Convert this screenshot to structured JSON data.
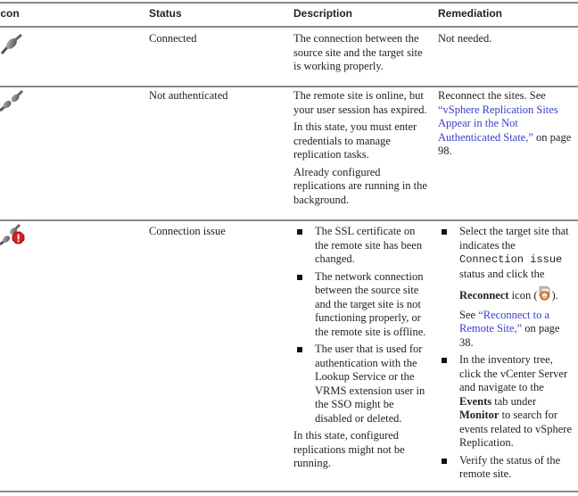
{
  "table": {
    "headers": {
      "icon": "Icon",
      "status": "Status",
      "description": "Description",
      "remediation": "Remediation"
    },
    "rows": [
      {
        "icon": "plug-connected-icon",
        "status": "Connected",
        "description": [
          "The connection between the source site and the target site is working properly."
        ],
        "remediation": "Not needed."
      },
      {
        "icon": "plug-disconnected-icon",
        "status": "Not authenticated",
        "description": [
          "The remote site is online, but your user session has expired.",
          "In this state, you must enter credentials to manage replication tasks.",
          "Already configured replications are running in the background."
        ],
        "remediation": {
          "prefix": "Reconnect the sites. See ",
          "link": "“vSphere Replication Sites Appear in the Not Authenticated State,”",
          "suffix": " on page 98."
        }
      },
      {
        "icon": "plug-error-icon",
        "status": "Connection issue",
        "description_bullets": [
          "The SSL certificate on the remote site has been changed.",
          "The network connection between the source site and the target site is not functioning properly, or the remote site is offline.",
          "The user that is used for authentication with the Lookup Service or the VRMS extension user in the SSO might be disabled or deleted."
        ],
        "description_note": "In this state, configured replications might not be running.",
        "remediation_bullets": {
          "b1_pre": "Select the target site that indicates the ",
          "b1_code": "Connection issue",
          "b1_mid": " status and click the",
          "b1_bold": "Reconnect",
          "b1_icon_pre": " icon (",
          "b1_icon_post": ").",
          "b1_see": "See ",
          "b1_link": "“Reconnect to a Remote Site,”",
          "b1_suffix": " on page 38.",
          "b2_pre": "In the inventory tree, click the vCenter Server and navigate to the ",
          "b2_bold1": "Events",
          "b2_mid": " tab under ",
          "b2_bold2": "Monitor",
          "b2_post": " to search for events related to vSphere Replication.",
          "b3": "Verify the status of the remote site."
        }
      }
    ]
  }
}
